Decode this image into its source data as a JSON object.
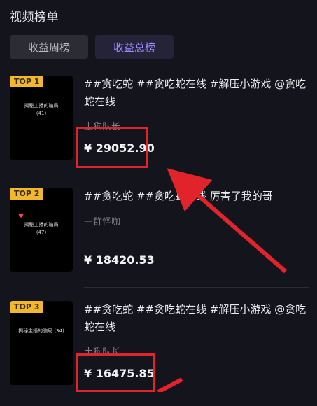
{
  "header": {
    "title": "视频榜单"
  },
  "tabs": [
    {
      "label": "收益周榜",
      "active": false
    },
    {
      "label": "收益总榜",
      "active": true
    }
  ],
  "items": [
    {
      "rank": "TOP 1",
      "thumb_caption": "揭秘主播的骗局\n(41)",
      "title": "##贪吃蛇 ##贪吃蛇在线 #解压小游戏 @贪吃蛇在线",
      "author": "土狗队长",
      "earning": "¥ 29052.90"
    },
    {
      "rank": "TOP 2",
      "thumb_caption": "揭秘主播的骗局\n(47)",
      "title": "##贪吃蛇 ##贪吃蛇在线 厉害了我的哥",
      "author": "一群怪咖",
      "earning": "¥ 18420.53"
    },
    {
      "rank": "TOP 3",
      "thumb_caption": "揭秘主播的骗局 (34)",
      "title": "##贪吃蛇 ##贪吃蛇在线 #解压小游戏 @贪吃蛇在线",
      "author": "土狗队长",
      "earning": "¥ 16475.85"
    }
  ],
  "colors": {
    "background": "#14151c",
    "active_tab_text": "#9d86ff",
    "badge": "#f2b72c",
    "annotation_red": "#e1232c"
  },
  "icons": [
    "heart-icon",
    "arrow-annotation"
  ]
}
